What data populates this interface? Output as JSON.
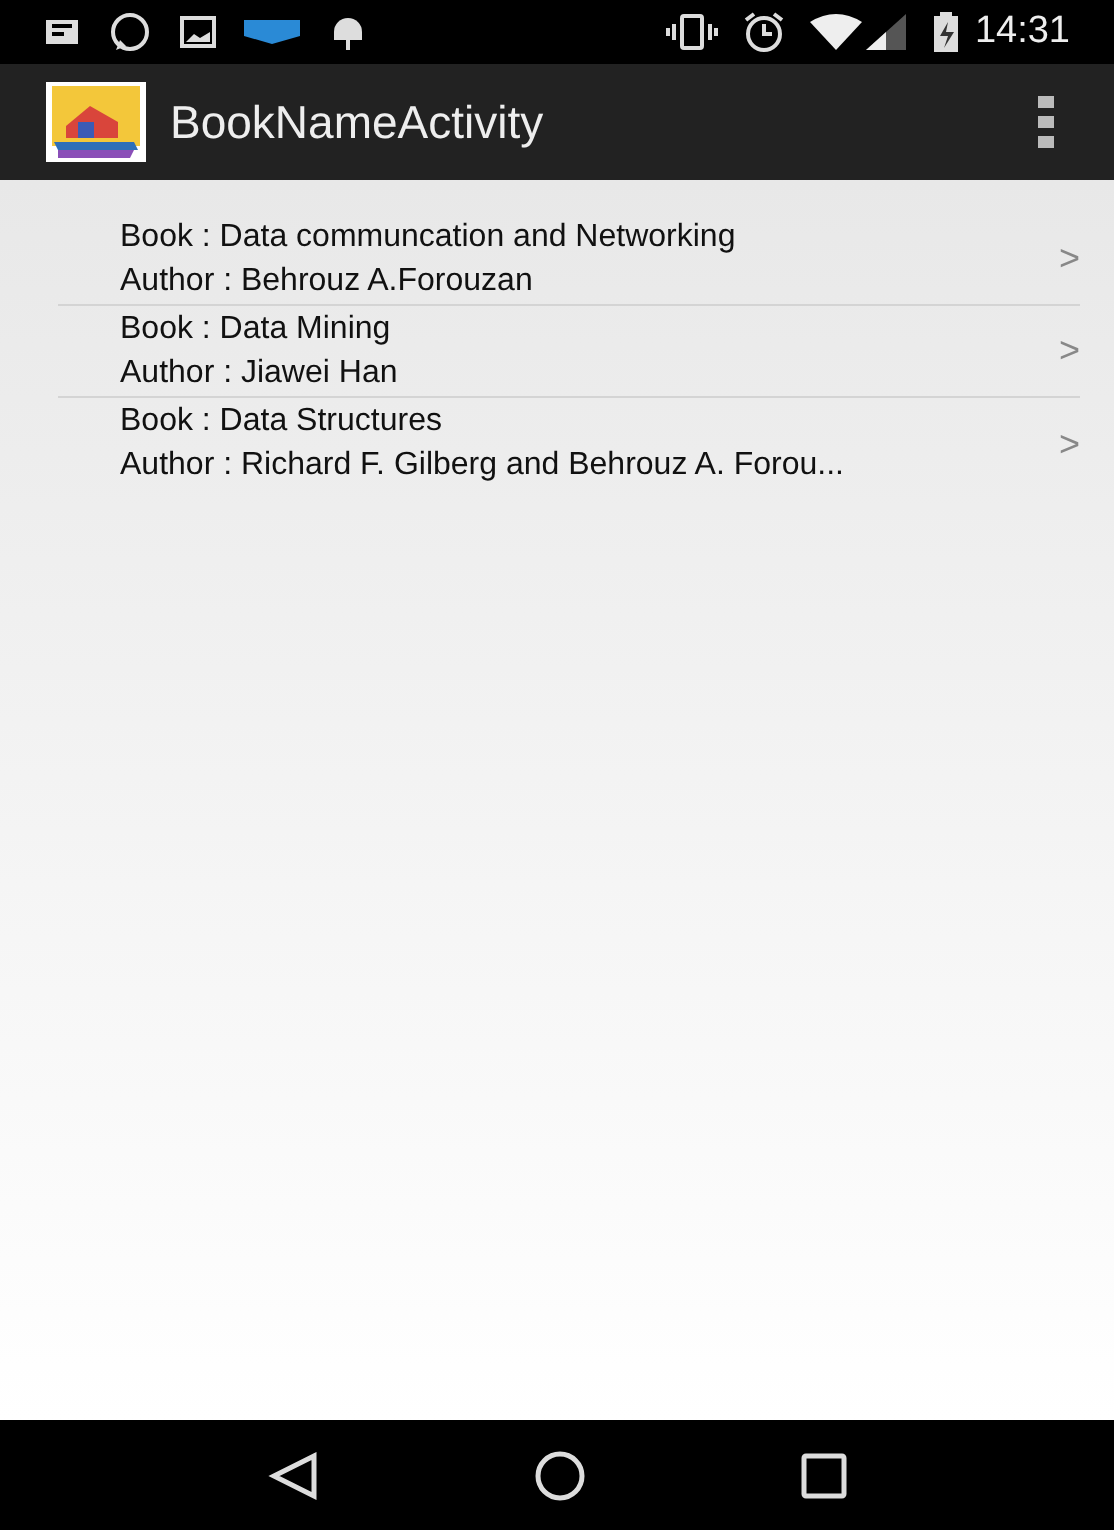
{
  "status_bar": {
    "time": "14:31"
  },
  "app_bar": {
    "title": "BookNameActivity"
  },
  "books": [
    {
      "book": "Book : Data communcation and Networking",
      "author": "Author : Behrouz A.Forouzan",
      "chevron": ">"
    },
    {
      "book": "Book : Data Mining",
      "author": "Author : Jiawei Han",
      "chevron": ">"
    },
    {
      "book": "Book : Data Structures",
      "author": "Author : Richard F. Gilberg and Behrouz A. Forou...",
      "chevron": ">"
    }
  ]
}
